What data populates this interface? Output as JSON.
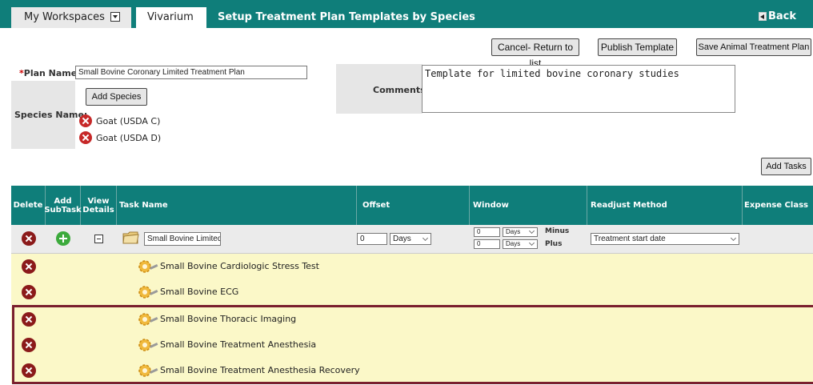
{
  "header": {
    "workspaces_label": "My Workspaces",
    "vivarium_label": "Vivarium",
    "page_title": "Setup Treatment Plan Templates by Species",
    "back_label": "Back"
  },
  "toolbar": {
    "cancel_label": "Cancel- Return to list",
    "publish_label": "Publish Template",
    "save_label": "Save Animal Treatment Plan"
  },
  "form": {
    "plan_name_label": "Plan Name:",
    "plan_name_required": "*",
    "plan_name_value": "Small Bovine Coronary Limited Treatment Plan",
    "species_label": "Species Name:",
    "add_species_label": "Add Species",
    "species": [
      "Goat (USDA C)",
      "Goat (USDA D)"
    ],
    "comments_label": "Comments:",
    "comments_value": "Template for limited bovine coronary studies",
    "add_tasks_label": "Add Tasks"
  },
  "grid": {
    "headers": {
      "delete": "Delete",
      "add_subtask": "Add SubTask",
      "view_details": "View Details",
      "task_name": "Task Name",
      "offset": "Offset",
      "window": "Window",
      "readjust": "Readjust Method",
      "expense": "Expense Class"
    },
    "task": {
      "name": "Small Bovine Limited Ca",
      "offset_value": "0",
      "offset_unit": "Days",
      "window_minus_value": "0",
      "window_minus_unit": "Days",
      "window_minus_label": "Minus",
      "window_plus_value": "0",
      "window_plus_unit": "Days",
      "window_plus_label": "Plus",
      "readjust_value": "Treatment start date"
    },
    "subtasks": [
      "Small Bovine Cardiologic Stress Test",
      "Small Bovine ECG",
      "Small Bovine Thoracic Imaging",
      "Small Bovine Treatment Anesthesia",
      "Small Bovine Treatment Anesthesia Recovery"
    ]
  },
  "colors": {
    "header_teal": "#0f7e7a",
    "subtask_yellow": "#fbf8c8",
    "highlight_border": "#7a1f2e",
    "delete_red": "#8b1a1a",
    "add_green": "#3caa3c"
  }
}
